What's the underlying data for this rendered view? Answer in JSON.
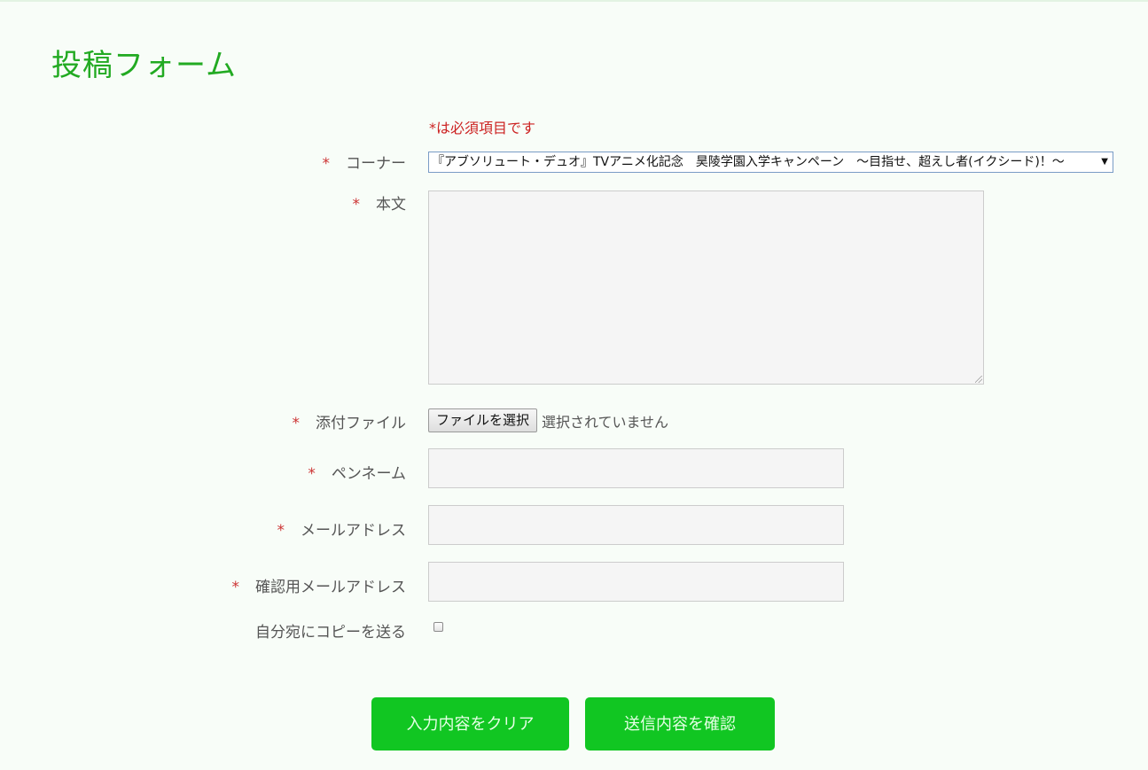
{
  "form": {
    "title": "投稿フォーム",
    "required_note": "*は必須項目です",
    "required_mark": "*",
    "fields": {
      "corner": {
        "label": "コーナー",
        "selected": "『アブソリュート・デュオ』TVアニメ化記念　昊陵学園入学キャンペーン　～目指せ、超えし者(イクシード)！～"
      },
      "body": {
        "label": "本文"
      },
      "attachment": {
        "label": "添付ファイル",
        "button_label": "ファイルを選択",
        "status": "選択されていません"
      },
      "pen_name": {
        "label": "ペンネーム"
      },
      "email": {
        "label": "メールアドレス"
      },
      "email_confirm": {
        "label": "確認用メールアドレス"
      },
      "send_copy": {
        "label": "自分宛にコピーを送る",
        "checked": false
      }
    },
    "buttons": {
      "clear": "入力内容をクリア",
      "confirm": "送信内容を確認"
    }
  },
  "colors": {
    "title": "#22aa22",
    "required": "#cc2222",
    "button": "#11c622",
    "background": "#f8fdf8"
  }
}
